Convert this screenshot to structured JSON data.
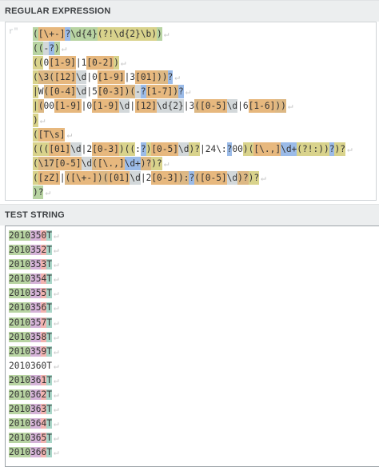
{
  "regex_section": {
    "title": "REGULAR EXPRESSION",
    "flag": "r\"",
    "pilcrow": "↵",
    "lines": [
      [
        {
          "t": "(",
          "c": "g1"
        },
        {
          "t": "[\\+-]",
          "c": "cc"
        },
        {
          "t": "?",
          "c": "qt"
        },
        {
          "t": "\\d{4}",
          "c": "g1"
        },
        {
          "t": "(?!",
          "c": "g2"
        },
        {
          "t": "\\d{2}\\b",
          "c": "g2"
        },
        {
          "t": ")",
          "c": "g2"
        },
        {
          "t": ")",
          "c": "g1"
        }
      ],
      [
        {
          "t": "((",
          "c": "g1"
        },
        {
          "t": "-",
          "c": "es"
        },
        {
          "t": "?",
          "c": "qt"
        },
        {
          "t": ")",
          "c": "g1"
        }
      ],
      [
        {
          "t": "((",
          "c": "g2"
        },
        {
          "t": "0",
          "c": ""
        },
        {
          "t": "[1-9]",
          "c": "cc"
        },
        {
          "t": "|",
          "c": ""
        },
        {
          "t": "1",
          "c": ""
        },
        {
          "t": "[0-2]",
          "c": "cc"
        },
        {
          "t": ")",
          "c": "g2"
        }
      ],
      [
        {
          "t": "(",
          "c": "g2"
        },
        {
          "t": "\\3",
          "c": "g3"
        },
        {
          "t": "(",
          "c": "g3"
        },
        {
          "t": "[12]",
          "c": "cc"
        },
        {
          "t": "\\d",
          "c": "es"
        },
        {
          "t": "|",
          "c": ""
        },
        {
          "t": "0",
          "c": ""
        },
        {
          "t": "[1-9]",
          "c": "cc"
        },
        {
          "t": "|",
          "c": ""
        },
        {
          "t": "3",
          "c": ""
        },
        {
          "t": "[01]",
          "c": "cc"
        },
        {
          "t": "))",
          "c": "g3"
        },
        {
          "t": "?",
          "c": "qt"
        }
      ],
      [
        {
          "t": "|",
          "c": "al"
        },
        {
          "t": "W",
          "c": ""
        },
        {
          "t": "(",
          "c": "g3"
        },
        {
          "t": "[0-4]",
          "c": "cc"
        },
        {
          "t": "\\d",
          "c": "es"
        },
        {
          "t": "|",
          "c": ""
        },
        {
          "t": "5",
          "c": ""
        },
        {
          "t": "[0-3]",
          "c": "cc"
        },
        {
          "t": ")(",
          "c": "g3"
        },
        {
          "t": "-",
          "c": "es"
        },
        {
          "t": "?",
          "c": "qt"
        },
        {
          "t": "[1-7]",
          "c": "cc"
        },
        {
          "t": ")",
          "c": "g3"
        },
        {
          "t": "?",
          "c": "qt"
        }
      ],
      [
        {
          "t": "|",
          "c": "al"
        },
        {
          "t": "(",
          "c": "g3"
        },
        {
          "t": "00",
          "c": ""
        },
        {
          "t": "[1-9]",
          "c": "cc"
        },
        {
          "t": "|",
          "c": ""
        },
        {
          "t": "0",
          "c": ""
        },
        {
          "t": "[1-9]",
          "c": "cc"
        },
        {
          "t": "\\d",
          "c": "es"
        },
        {
          "t": "|",
          "c": ""
        },
        {
          "t": "[12]",
          "c": "cc"
        },
        {
          "t": "\\d{2}",
          "c": "es"
        },
        {
          "t": "|",
          "c": ""
        },
        {
          "t": "3",
          "c": ""
        },
        {
          "t": "(",
          "c": "g3"
        },
        {
          "t": "[0-5]",
          "c": "cc"
        },
        {
          "t": "\\d",
          "c": "es"
        },
        {
          "t": "|",
          "c": ""
        },
        {
          "t": "6",
          "c": ""
        },
        {
          "t": "[1-6]",
          "c": "cc"
        },
        {
          "t": "))",
          "c": "g3"
        }
      ],
      [
        {
          "t": ")",
          "c": "g2"
        }
      ],
      [
        {
          "t": "(",
          "c": "g2"
        },
        {
          "t": "[T\\s]",
          "c": "cc"
        }
      ],
      [
        {
          "t": "(((",
          "c": "g2"
        },
        {
          "t": "[01]",
          "c": "cc"
        },
        {
          "t": "\\d",
          "c": "es"
        },
        {
          "t": "|",
          "c": ""
        },
        {
          "t": "2",
          "c": ""
        },
        {
          "t": "[0-3]",
          "c": "cc"
        },
        {
          "t": ")((",
          "c": "g2"
        },
        {
          "t": ":",
          "c": ""
        },
        {
          "t": "?",
          "c": "qt"
        },
        {
          "t": ")",
          "c": "g2"
        },
        {
          "t": "[0-5]",
          "c": "cc"
        },
        {
          "t": "\\d",
          "c": "es"
        },
        {
          "t": ")?",
          "c": "g2"
        },
        {
          "t": "|",
          "c": ""
        },
        {
          "t": "24\\:",
          "c": ""
        },
        {
          "t": "?",
          "c": "qt"
        },
        {
          "t": "00",
          "c": ""
        },
        {
          "t": ")(",
          "c": "g2"
        },
        {
          "t": "[\\.,]",
          "c": "cc"
        },
        {
          "t": "\\d+",
          "c": "qt"
        },
        {
          "t": "(?!:",
          "c": "g2"
        },
        {
          "t": "))",
          "c": "g2"
        },
        {
          "t": "?",
          "c": "qt"
        },
        {
          "t": ")?",
          "c": "g2"
        }
      ],
      [
        {
          "t": "(",
          "c": "g2"
        },
        {
          "t": "\\17",
          "c": "g3"
        },
        {
          "t": "[0-5]",
          "c": "cc"
        },
        {
          "t": "\\d",
          "c": "es"
        },
        {
          "t": "(",
          "c": "g3"
        },
        {
          "t": "[\\.,]",
          "c": "cc"
        },
        {
          "t": "\\d+",
          "c": "qt"
        },
        {
          "t": ")?",
          "c": "g3"
        },
        {
          "t": ")?",
          "c": "g2"
        }
      ],
      [
        {
          "t": "(",
          "c": "g2"
        },
        {
          "t": "[zZ]",
          "c": "cc"
        },
        {
          "t": "|",
          "c": ""
        },
        {
          "t": "(",
          "c": "g3"
        },
        {
          "t": "[\\+-]",
          "c": "cc"
        },
        {
          "t": ")(",
          "c": "g3"
        },
        {
          "t": "[01]",
          "c": "cc"
        },
        {
          "t": "\\d",
          "c": "es"
        },
        {
          "t": "|",
          "c": ""
        },
        {
          "t": "2",
          "c": ""
        },
        {
          "t": "[0-3]",
          "c": "cc"
        },
        {
          "t": "):",
          "c": "g3"
        },
        {
          "t": "?",
          "c": "qt"
        },
        {
          "t": "(",
          "c": "g3"
        },
        {
          "t": "[0-5]",
          "c": "cc"
        },
        {
          "t": "\\d",
          "c": "es"
        },
        {
          "t": ")?",
          "c": "g3"
        },
        {
          "t": ")?",
          "c": "g2"
        }
      ],
      [
        {
          "t": ")?",
          "c": "g1"
        }
      ]
    ]
  },
  "test_section": {
    "title": "TEST STRING",
    "lines": [
      {
        "a": "2010",
        "b": "35",
        "c": "0",
        "d": "T",
        "m": true
      },
      {
        "a": "2010",
        "b": "35",
        "c": "2",
        "d": "T",
        "m": true
      },
      {
        "a": "2010",
        "b": "35",
        "c": "3",
        "d": "T",
        "m": true
      },
      {
        "a": "2010",
        "b": "35",
        "c": "4",
        "d": "T",
        "m": true
      },
      {
        "a": "2010",
        "b": "35",
        "c": "5",
        "d": "T",
        "m": true
      },
      {
        "a": "2010",
        "b": "35",
        "c": "6",
        "d": "T",
        "m": true
      },
      {
        "a": "2010",
        "b": "35",
        "c": "7",
        "d": "T",
        "m": true
      },
      {
        "a": "2010",
        "b": "35",
        "c": "8",
        "d": "T",
        "m": true
      },
      {
        "a": "2010",
        "b": "35",
        "c": "9",
        "d": "T",
        "m": true
      },
      {
        "a": "2010",
        "b": "36",
        "c": "0",
        "d": "T",
        "m": false
      },
      {
        "a": "2010",
        "b": "36",
        "c": "1",
        "d": "T",
        "m": true
      },
      {
        "a": "2010",
        "b": "36",
        "c": "2",
        "d": "T",
        "m": true
      },
      {
        "a": "2010",
        "b": "36",
        "c": "3",
        "d": "T",
        "m": true
      },
      {
        "a": "2010",
        "b": "36",
        "c": "4",
        "d": "T",
        "m": true
      },
      {
        "a": "2010",
        "b": "36",
        "c": "5",
        "d": "T",
        "m": true
      },
      {
        "a": "2010",
        "b": "36",
        "c": "6",
        "d": "T",
        "m": true
      }
    ]
  }
}
